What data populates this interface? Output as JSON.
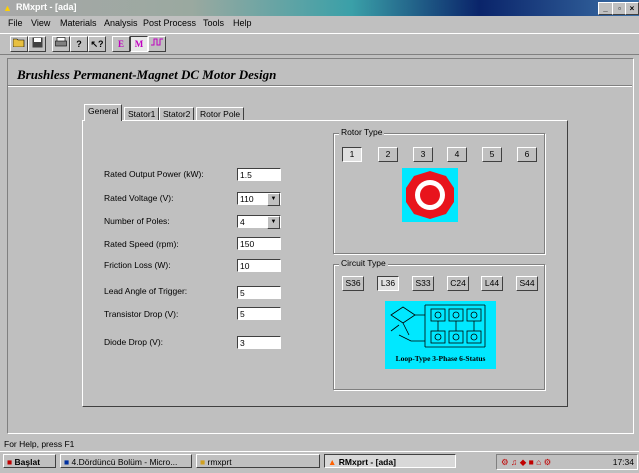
{
  "window": {
    "title": "RMxprt - [ada]"
  },
  "menu": [
    "File",
    "View",
    "Materials",
    "Analysis",
    "Post Process",
    "Tools",
    "Help"
  ],
  "toolbar": {
    "e_label": "E",
    "m_label": "M"
  },
  "page_title": "Brushless Permanent-Magnet DC Motor Design",
  "tabs": [
    "General",
    "Stator1",
    "Stator2",
    "Rotor Pole"
  ],
  "form": [
    {
      "label": "Rated Output Power (kW):",
      "value": "1.5"
    },
    {
      "label": "Rated Voltage (V):",
      "value": "110"
    },
    {
      "label": "Number of Poles:",
      "value": "4"
    },
    {
      "label": "Rated Speed (rpm):",
      "value": "150"
    },
    {
      "label": "Friction  Loss (W):",
      "value": "10"
    },
    {
      "label": "Lead Angle of Trigger:",
      "value": "5"
    },
    {
      "label": "Transistor Drop (V):",
      "value": "5"
    },
    {
      "label": "Diode Drop (V):",
      "value": "3"
    }
  ],
  "rotor_type": {
    "title": "Rotor Type",
    "options": [
      "1",
      "2",
      "3",
      "4",
      "5",
      "6"
    ],
    "selected": "1"
  },
  "circuit_type": {
    "title": "Circuit Type",
    "options": [
      "S36",
      "L36",
      "S33",
      "C24",
      "L44",
      "S44"
    ],
    "selected": "L36",
    "diagram_caption": "Loop-Type 3-Phase 6-Status"
  },
  "status_bar": "For Help, press F1",
  "taskbar": {
    "start": "Başlat",
    "tasks": [
      "4.Dördüncü Bolüm - Micro...",
      "rmxprt",
      "RMxprt - [ada]"
    ],
    "clock": "17:34"
  },
  "colors": {
    "image_bg": "#00e8ff",
    "rotor_red": "#e8141c",
    "title_active": "#0a246a"
  }
}
